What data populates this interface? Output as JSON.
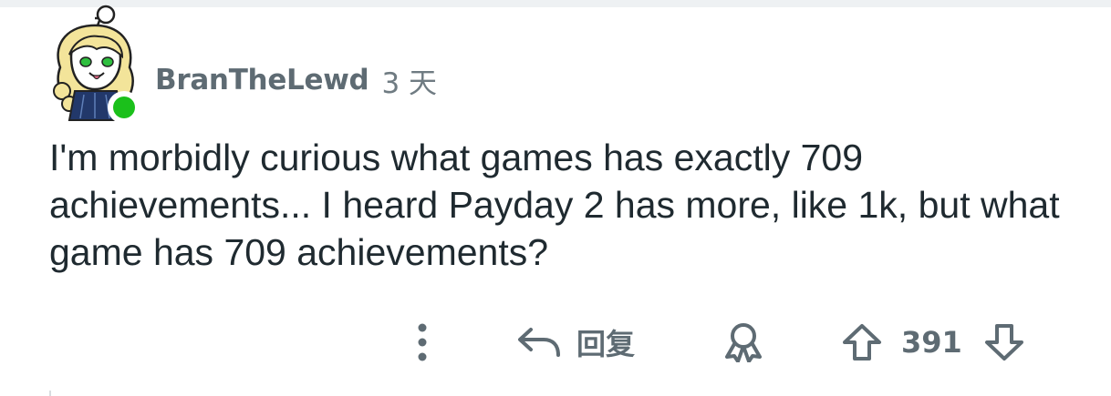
{
  "comment": {
    "username": "BranTheLewd",
    "timestamp": "3 天",
    "body": "I'm morbidly curious what games has exactly 709 achievements... I heard Payday 2 has more, like 1k, but what game has 709 achievements?",
    "author_online": true
  },
  "actions": {
    "more_icon": "vertical-ellipsis",
    "reply_icon": "reply-arrow",
    "reply_label": "回复",
    "award_icon": "award-ribbon",
    "upvote_icon": "arrow-up-outline",
    "vote_count": "391",
    "downvote_icon": "arrow-down-outline"
  },
  "colors": {
    "text": "#1f2a30",
    "muted": "#5e6b73",
    "online": "#1bc01b"
  }
}
